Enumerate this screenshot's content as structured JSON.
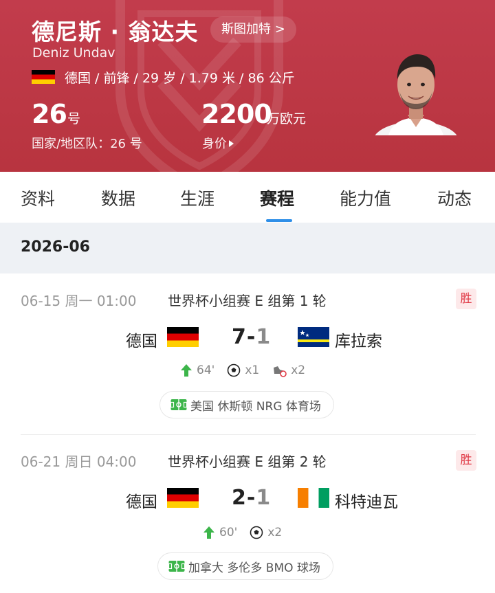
{
  "player": {
    "name_cn": "德尼斯 · 翁达夫",
    "name_en": "Deniz Undav",
    "club_link": "斯图加特 >",
    "info_line": "德国 / 前锋 / 29 岁 / 1.79 米 / 86 公斤",
    "number": "26",
    "number_unit": "号",
    "number_label": "国家/地区队：26 号",
    "value": "2200",
    "value_unit": "万欧元",
    "value_label": "身价",
    "colors": {
      "header": "#b8343f",
      "accent": "#2f8fe8",
      "win_badge_bg": "#fde9ea",
      "win_badge_text": "#e03a46"
    }
  },
  "tabs": [
    {
      "label": "资料",
      "active": false
    },
    {
      "label": "数据",
      "active": false
    },
    {
      "label": "生涯",
      "active": false
    },
    {
      "label": "赛程",
      "active": true
    },
    {
      "label": "能力值",
      "active": false
    },
    {
      "label": "动态",
      "active": false
    }
  ],
  "month": "2026-06",
  "matches": [
    {
      "datetime": "06-15  周一 01:00",
      "competition": "世界杯小组赛 E 组第 1 轮",
      "result": "胜",
      "home": {
        "name": "德国",
        "flag_icon": "germany-flag-icon"
      },
      "score_home": "7",
      "score_sep": "-",
      "score_away": "1",
      "away": {
        "name": "库拉索",
        "flag_icon": "curacao-flag-icon"
      },
      "stats": {
        "sub_in": "64'",
        "goals": "x1",
        "assists": "x2"
      },
      "venue": "美国 休斯顿 NRG 体育场"
    },
    {
      "datetime": "06-21  周日 04:00",
      "competition": "世界杯小组赛 E 组第 2 轮",
      "result": "胜",
      "home": {
        "name": "德国",
        "flag_icon": "germany-flag-icon"
      },
      "score_home": "2",
      "score_sep": "-",
      "score_away": "1",
      "away": {
        "name": "科特迪瓦",
        "flag_icon": "ivory-coast-flag-icon"
      },
      "stats": {
        "sub_in": "60'",
        "goals": "x2"
      },
      "venue": "加拿大 多伦多 BMO 球场"
    }
  ]
}
